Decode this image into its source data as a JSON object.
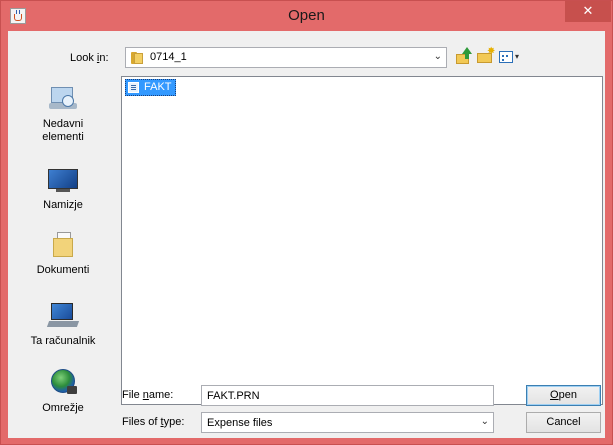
{
  "window": {
    "title": "Open",
    "close_glyph": "✕"
  },
  "toolbar": {
    "look_in_pre": "Look ",
    "look_in_mn": "i",
    "look_in_post": "n:",
    "look_in_value": "0714_1",
    "dropdown_glyph": "⌄",
    "view_caret": "▾",
    "new_folder_glyph": "✸"
  },
  "places": [
    {
      "label": "Nedavni elementi",
      "icon": "recent-items-icon"
    },
    {
      "label": "Namizje",
      "icon": "desktop-icon"
    },
    {
      "label": "Dokumenti",
      "icon": "documents-icon"
    },
    {
      "label": "Ta računalnik",
      "icon": "this-pc-icon"
    },
    {
      "label": "Omrežje",
      "icon": "network-icon"
    }
  ],
  "files": [
    {
      "name": "FAKT",
      "selected": true
    }
  ],
  "file_name": {
    "label_pre": "File ",
    "label_mn": "n",
    "label_post": "ame:",
    "value": "FAKT.PRN"
  },
  "file_type": {
    "label_pre": "Files of ",
    "label_mn": "t",
    "label_post": "ype:",
    "value": "Expense files"
  },
  "buttons": {
    "open_mn": "O",
    "open_rest": "pen",
    "cancel": "Cancel"
  },
  "colors": {
    "titlebar": "#e36a6a",
    "close": "#c7504d",
    "selection": "#3399ff"
  }
}
